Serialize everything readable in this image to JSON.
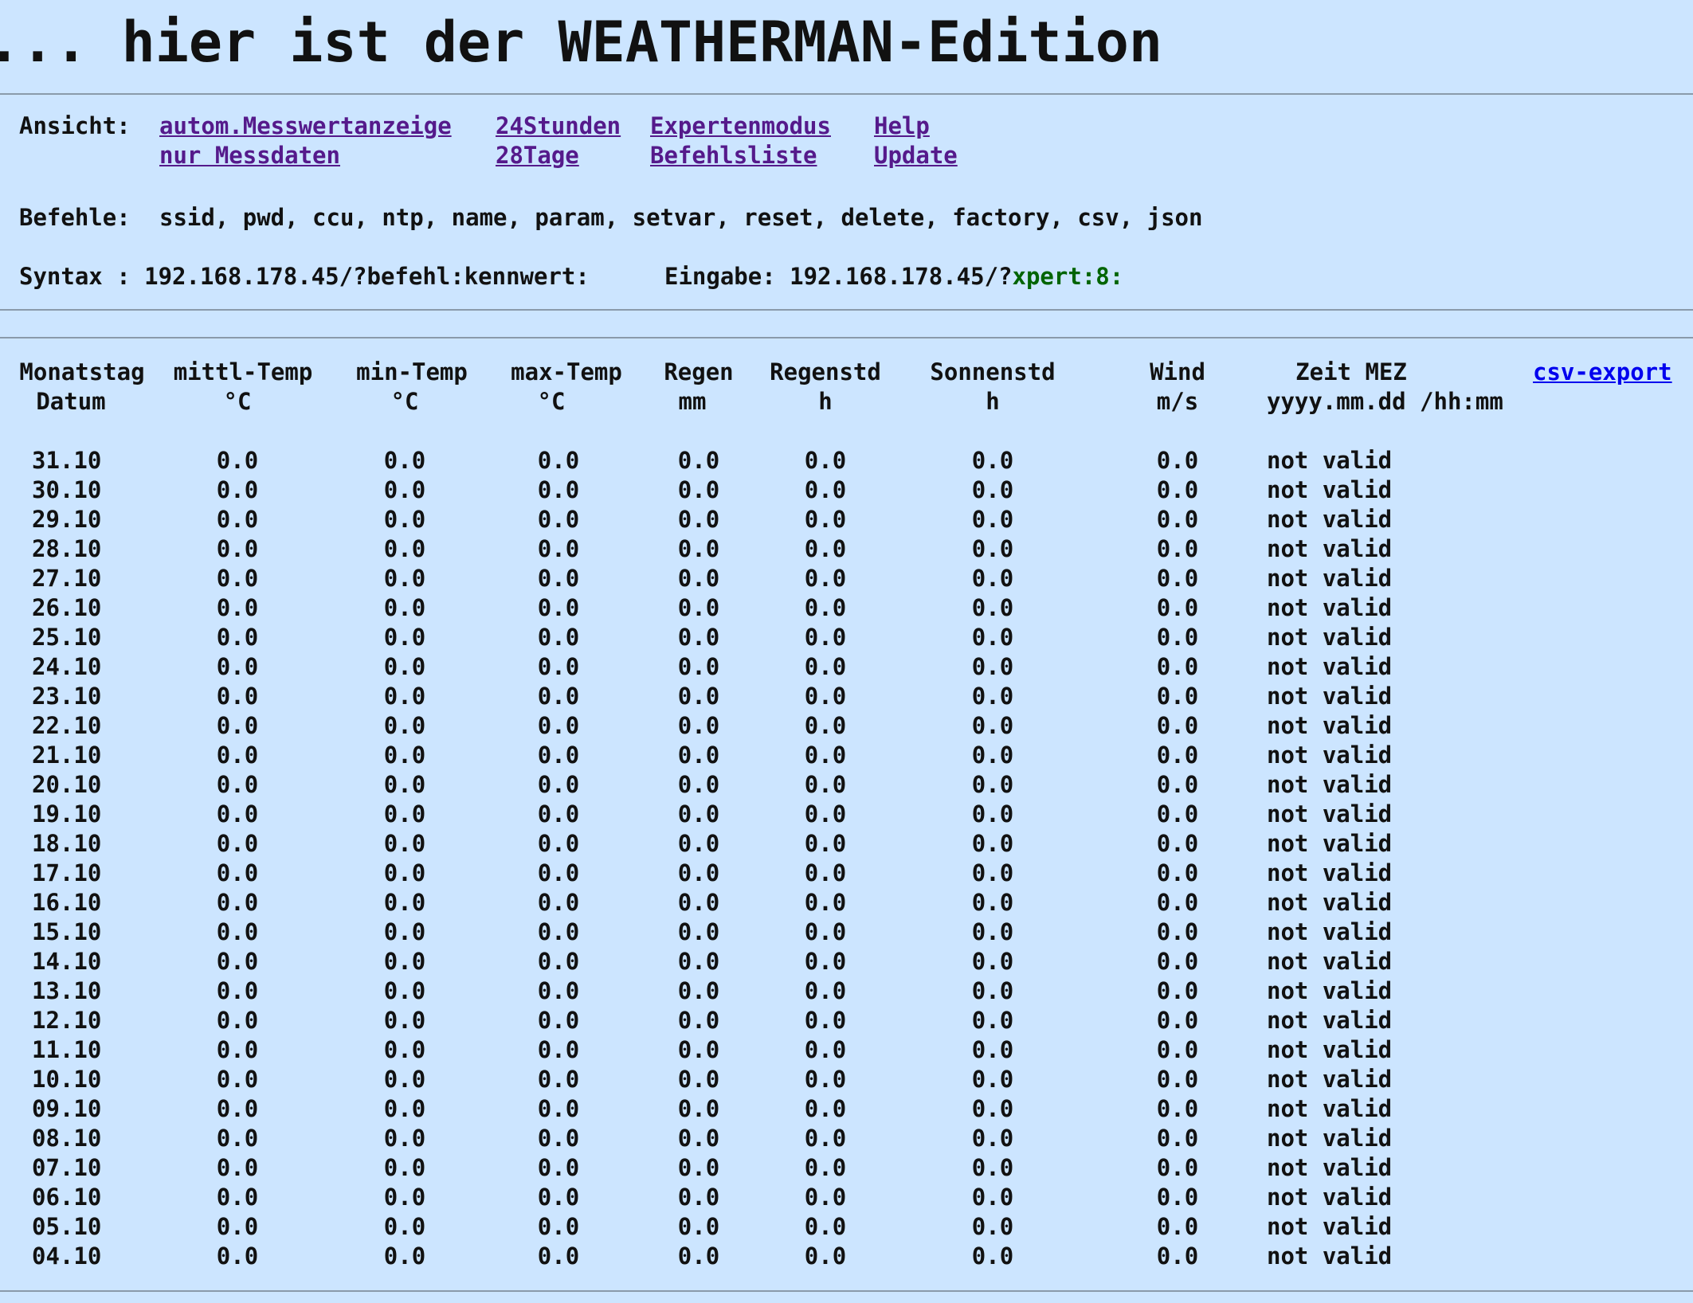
{
  "title": "... hier ist der WEATHERMAN-Edition",
  "nav": {
    "label": "Ansicht:",
    "links": [
      {
        "id": "autom",
        "label": "autom.Messwertanzeige"
      },
      {
        "id": "messdaten",
        "label": "nur Messdaten"
      },
      {
        "id": "h24",
        "label": "24Stunden"
      },
      {
        "id": "d28",
        "label": "28Tage"
      },
      {
        "id": "expert",
        "label": "Expertenmodus"
      },
      {
        "id": "befehlsliste",
        "label": "Befehlsliste"
      },
      {
        "id": "help",
        "label": "Help"
      },
      {
        "id": "update",
        "label": "Update"
      }
    ]
  },
  "commands": {
    "label": "Befehle:",
    "list": "ssid, pwd, ccu, ntp, name, param, setvar, reset, delete, factory, csv, json"
  },
  "syntax": {
    "label": "Syntax : 192.168.178.45/?befehl:kennwert:",
    "input_label": "Eingabe: 192.168.178.45/?",
    "input_value": "xpert:8:"
  },
  "table": {
    "headers": [
      {
        "line1": "Monatstag",
        "line2": "Datum"
      },
      {
        "line1": "mittl-Temp",
        "line2": "°C"
      },
      {
        "line1": "min-Temp",
        "line2": "°C"
      },
      {
        "line1": "max-Temp",
        "line2": "°C"
      },
      {
        "line1": "Regen",
        "line2": "mm"
      },
      {
        "line1": "Regenstd",
        "line2": "h"
      },
      {
        "line1": "Sonnenstd",
        "line2": "h"
      },
      {
        "line1": "Wind",
        "line2": "m/s"
      },
      {
        "line1": "Zeit MEZ",
        "line2": "yyyy.mm.dd /hh:mm"
      }
    ],
    "csv_export": "csv-export",
    "rows": [
      [
        "31.10",
        "0.0",
        "0.0",
        "0.0",
        "0.0",
        "0.0",
        "0.0",
        "0.0",
        "not valid"
      ],
      [
        "30.10",
        "0.0",
        "0.0",
        "0.0",
        "0.0",
        "0.0",
        "0.0",
        "0.0",
        "not valid"
      ],
      [
        "29.10",
        "0.0",
        "0.0",
        "0.0",
        "0.0",
        "0.0",
        "0.0",
        "0.0",
        "not valid"
      ],
      [
        "28.10",
        "0.0",
        "0.0",
        "0.0",
        "0.0",
        "0.0",
        "0.0",
        "0.0",
        "not valid"
      ],
      [
        "27.10",
        "0.0",
        "0.0",
        "0.0",
        "0.0",
        "0.0",
        "0.0",
        "0.0",
        "not valid"
      ],
      [
        "26.10",
        "0.0",
        "0.0",
        "0.0",
        "0.0",
        "0.0",
        "0.0",
        "0.0",
        "not valid"
      ],
      [
        "25.10",
        "0.0",
        "0.0",
        "0.0",
        "0.0",
        "0.0",
        "0.0",
        "0.0",
        "not valid"
      ],
      [
        "24.10",
        "0.0",
        "0.0",
        "0.0",
        "0.0",
        "0.0",
        "0.0",
        "0.0",
        "not valid"
      ],
      [
        "23.10",
        "0.0",
        "0.0",
        "0.0",
        "0.0",
        "0.0",
        "0.0",
        "0.0",
        "not valid"
      ],
      [
        "22.10",
        "0.0",
        "0.0",
        "0.0",
        "0.0",
        "0.0",
        "0.0",
        "0.0",
        "not valid"
      ],
      [
        "21.10",
        "0.0",
        "0.0",
        "0.0",
        "0.0",
        "0.0",
        "0.0",
        "0.0",
        "not valid"
      ],
      [
        "20.10",
        "0.0",
        "0.0",
        "0.0",
        "0.0",
        "0.0",
        "0.0",
        "0.0",
        "not valid"
      ],
      [
        "19.10",
        "0.0",
        "0.0",
        "0.0",
        "0.0",
        "0.0",
        "0.0",
        "0.0",
        "not valid"
      ],
      [
        "18.10",
        "0.0",
        "0.0",
        "0.0",
        "0.0",
        "0.0",
        "0.0",
        "0.0",
        "not valid"
      ],
      [
        "17.10",
        "0.0",
        "0.0",
        "0.0",
        "0.0",
        "0.0",
        "0.0",
        "0.0",
        "not valid"
      ],
      [
        "16.10",
        "0.0",
        "0.0",
        "0.0",
        "0.0",
        "0.0",
        "0.0",
        "0.0",
        "not valid"
      ],
      [
        "15.10",
        "0.0",
        "0.0",
        "0.0",
        "0.0",
        "0.0",
        "0.0",
        "0.0",
        "not valid"
      ],
      [
        "14.10",
        "0.0",
        "0.0",
        "0.0",
        "0.0",
        "0.0",
        "0.0",
        "0.0",
        "not valid"
      ],
      [
        "13.10",
        "0.0",
        "0.0",
        "0.0",
        "0.0",
        "0.0",
        "0.0",
        "0.0",
        "not valid"
      ],
      [
        "12.10",
        "0.0",
        "0.0",
        "0.0",
        "0.0",
        "0.0",
        "0.0",
        "0.0",
        "not valid"
      ],
      [
        "11.10",
        "0.0",
        "0.0",
        "0.0",
        "0.0",
        "0.0",
        "0.0",
        "0.0",
        "not valid"
      ],
      [
        "10.10",
        "0.0",
        "0.0",
        "0.0",
        "0.0",
        "0.0",
        "0.0",
        "0.0",
        "not valid"
      ],
      [
        "09.10",
        "0.0",
        "0.0",
        "0.0",
        "0.0",
        "0.0",
        "0.0",
        "0.0",
        "not valid"
      ],
      [
        "08.10",
        "0.0",
        "0.0",
        "0.0",
        "0.0",
        "0.0",
        "0.0",
        "0.0",
        "not valid"
      ],
      [
        "07.10",
        "0.0",
        "0.0",
        "0.0",
        "0.0",
        "0.0",
        "0.0",
        "0.0",
        "not valid"
      ],
      [
        "06.10",
        "0.0",
        "0.0",
        "0.0",
        "0.0",
        "0.0",
        "0.0",
        "0.0",
        "not valid"
      ],
      [
        "05.10",
        "0.0",
        "0.0",
        "0.0",
        "0.0",
        "0.0",
        "0.0",
        "0.0",
        "not valid"
      ],
      [
        "04.10",
        "0.0",
        "0.0",
        "0.0",
        "0.0",
        "0.0",
        "0.0",
        "0.0",
        "not valid"
      ]
    ]
  }
}
